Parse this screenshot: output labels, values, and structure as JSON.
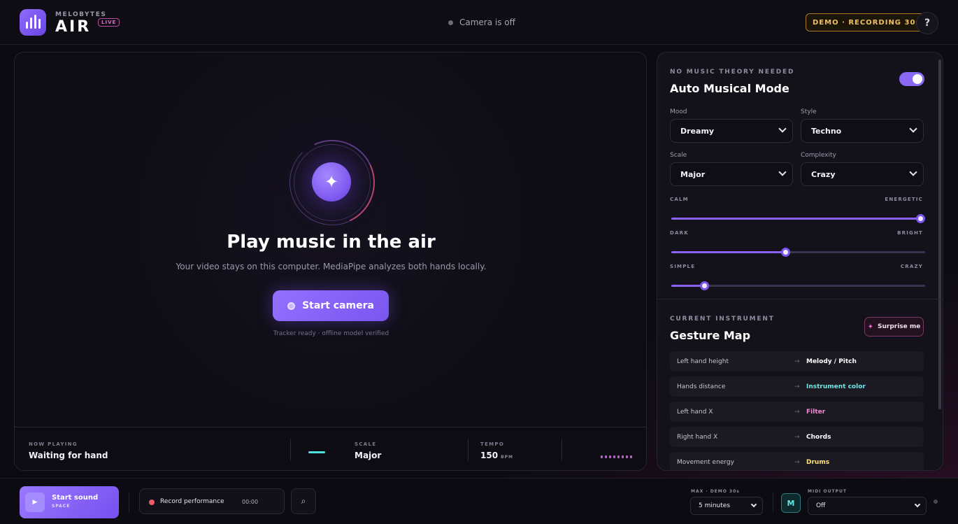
{
  "header": {
    "brand_small": "MELOBYTES",
    "brand_big": "AIR",
    "live_badge": "LIVE",
    "camera_status": "Camera is off",
    "demo_badge": "DEMO · RECORDING 30s",
    "help": "?"
  },
  "stage": {
    "title": "Play music in the air",
    "subtitle": "Your video stays on this computer. MediaPipe analyzes both hands locally.",
    "start_camera": "Start camera",
    "tracker_status": "Tracker ready · offline model verified",
    "footer": {
      "now_playing_label": "NOW PLAYING",
      "now_playing_value": "Waiting for hand",
      "scale_label": "SCALE",
      "scale_value": "Major",
      "tempo_label": "TEMPO",
      "tempo_value": "150",
      "tempo_unit": "BPM"
    }
  },
  "panel": {
    "eyebrow": "NO MUSIC THEORY NEEDED",
    "title": "Auto Musical Mode",
    "auto_mode_on": true,
    "mood_label": "Mood",
    "mood_value": "Dreamy",
    "style_label": "Style",
    "style_value": "Techno",
    "scale_label": "Scale",
    "scale_value": "Major",
    "complexity_label": "Complexity",
    "complexity_value": "Crazy",
    "sliders": [
      {
        "left": "CALM",
        "right": "ENERGETIC",
        "value": 0.98
      },
      {
        "left": "DARK",
        "right": "BRIGHT",
        "value": 0.45
      },
      {
        "left": "SIMPLE",
        "right": "CRAZY",
        "value": 0.13
      }
    ],
    "instrument_eyebrow": "CURRENT INSTRUMENT",
    "gesture_title": "Gesture Map",
    "surprise": "Surprise me",
    "gestures": [
      {
        "gesture": "Left hand height",
        "arrow": "→",
        "target": "Melody / Pitch",
        "color": "#ffffff"
      },
      {
        "gesture": "Hands distance",
        "arrow": "→",
        "target": "Instrument color",
        "color": "#6fe6e6"
      },
      {
        "gesture": "Left hand X",
        "arrow": "→",
        "target": "Filter",
        "color": "#f08ad6"
      },
      {
        "gesture": "Right hand X",
        "arrow": "→",
        "target": "Chords",
        "color": "#ffffff"
      },
      {
        "gesture": "Movement energy",
        "arrow": "→",
        "target": "Drums",
        "color": "#ffe27a"
      }
    ]
  },
  "bottom": {
    "start_sound": "Start sound",
    "start_sound_key": "SPACE",
    "record": "Record performance",
    "record_time": "00:00",
    "max_label": "MAX · DEMO 30s",
    "max_value": "5 minutes",
    "midi_icon": "M",
    "midi_label": "MIDI OUTPUT",
    "midi_value": "Off"
  }
}
